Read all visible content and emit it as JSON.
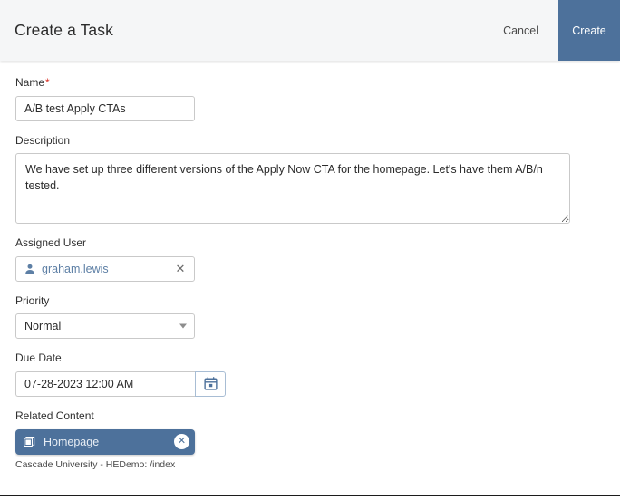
{
  "header": {
    "title": "Create a Task",
    "cancel_label": "Cancel",
    "create_label": "Create"
  },
  "form": {
    "name": {
      "label": "Name",
      "required_marker": "*",
      "value": "A/B test Apply CTAs",
      "placeholder": ""
    },
    "description": {
      "label": "Description",
      "value": "We have set up three different versions of the Apply Now CTA for the homepage. Let's have them A/B/n tested.",
      "placeholder": ""
    },
    "assigned_user": {
      "label": "Assigned User",
      "value": "graham.lewis",
      "clear_label": "✕",
      "icon": "person-icon"
    },
    "priority": {
      "label": "Priority",
      "value": "Normal",
      "options": [
        "Normal"
      ],
      "caret_icon": "chevron-down-icon"
    },
    "due_date": {
      "label": "Due Date",
      "value": "07-28-2023 12:00 AM",
      "placeholder": "",
      "calendar_icon": "calendar-icon"
    },
    "related_content": {
      "label": "Related Content",
      "chip_label": "Homepage",
      "chip_icon": "pages-icon",
      "remove_label": "✕",
      "caption": "Cascade University - HEDemo: /index"
    }
  },
  "colors": {
    "accent_blue": "#4d719b",
    "header_bg": "#f5f6f7",
    "required_red": "#d93025",
    "token_text_blue": "#5d7fa5"
  }
}
